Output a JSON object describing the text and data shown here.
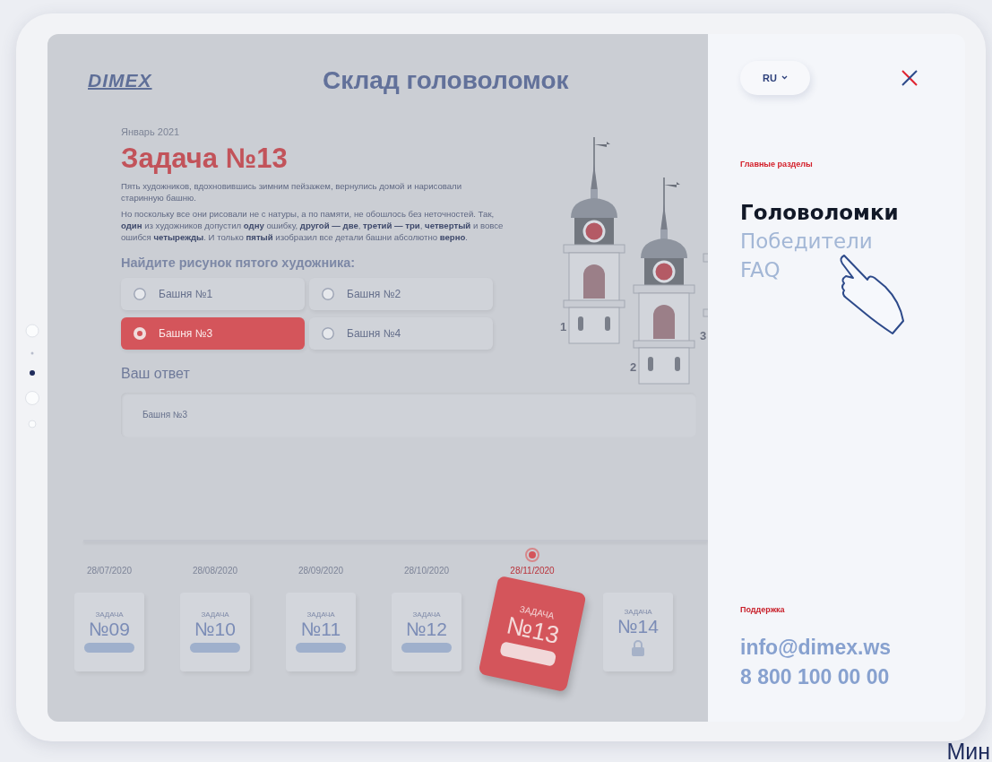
{
  "header": {
    "logo": "DIMEX",
    "title": "Склад головоломок"
  },
  "task": {
    "month": "Январь 2021",
    "title": "Задача №13",
    "paragraphs": [
      "Пять художников, вдохновившись зимним пейзажем, вернулись домой и нарисовали старинную башню.",
      "Но поскольку все они рисовали не с натуры, а по памяти, не обошлось без неточностей. Так, **один** из художников допустил **одну** ошибку, **другой — две**, **третий — три**, **четвертый** и вовсе ошибся **четырежды**. И только **пятый** изобразил все детали башни абсолютно **верно**."
    ],
    "question": "Найдите рисунок пятого художника:",
    "options": [
      {
        "label": "Башня №1",
        "selected": false
      },
      {
        "label": "Башня №2",
        "selected": false
      },
      {
        "label": "Башня №3",
        "selected": true
      },
      {
        "label": "Башня №4",
        "selected": false
      }
    ],
    "answer_label": "Ваш ответ",
    "answer": {
      "value": "Башня №3"
    }
  },
  "illustration": {
    "tower_labels": [
      "1",
      "2",
      "3"
    ]
  },
  "timeline": [
    {
      "date": "28/07/2020",
      "caption": "ЗАДАЧА",
      "number": "№09",
      "selected": false,
      "locked": false
    },
    {
      "date": "28/08/2020",
      "caption": "ЗАДАЧА",
      "number": "№10",
      "selected": false,
      "locked": false
    },
    {
      "date": "28/09/2020",
      "caption": "ЗАДАЧА",
      "number": "№11",
      "selected": false,
      "locked": false
    },
    {
      "date": "28/10/2020",
      "caption": "ЗАДАЧА",
      "number": "№12",
      "selected": false,
      "locked": false
    },
    {
      "date": "28/11/2020",
      "caption": "ЗАДАЧА",
      "number": "№13",
      "selected": true,
      "locked": false
    },
    {
      "caption": "ЗАДАЧА",
      "number": "№14",
      "selected": false,
      "locked": true
    }
  ],
  "menu": {
    "language": "RU",
    "section_label": "Главные разделы",
    "items": [
      {
        "label": "Головоломки",
        "selected": true
      },
      {
        "label": "Победители",
        "selected": false
      },
      {
        "label": "FAQ",
        "selected": false
      }
    ],
    "support_label": "Поддержка",
    "email": "info@dimex.ws",
    "phone": "8 800 100 00 00"
  },
  "footer_fragment": "Мин"
}
